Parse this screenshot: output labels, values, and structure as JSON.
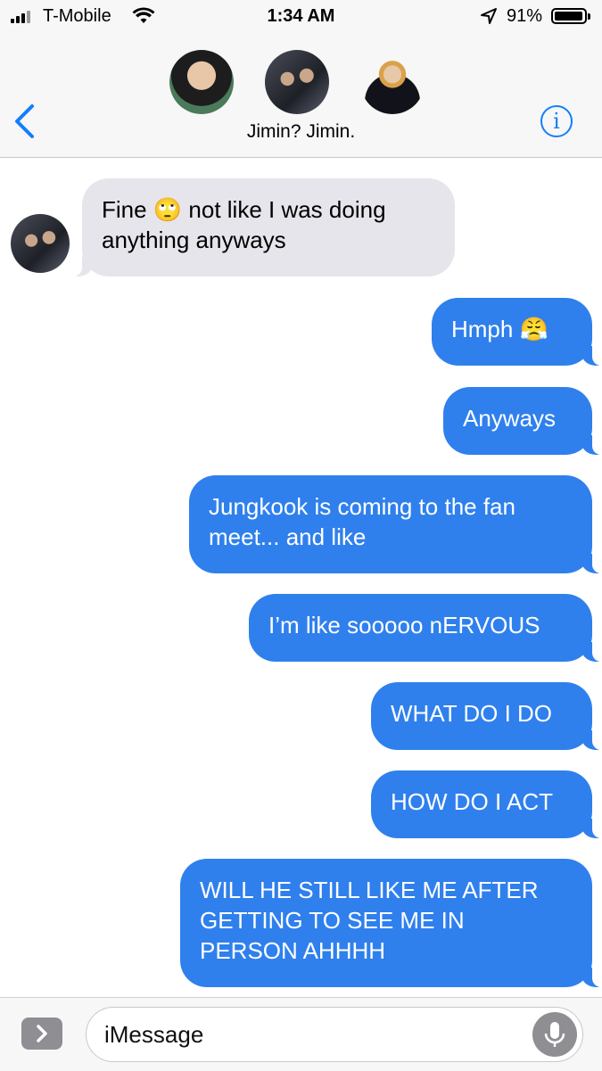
{
  "status_bar": {
    "carrier": "T-Mobile",
    "time": "1:34 AM",
    "battery_percent": "91%",
    "battery_level": 0.91
  },
  "header": {
    "group_name": "Jimin? Jimin.",
    "back_icon": "chevron-left-icon",
    "info_icon": "info-icon",
    "info_label": "i",
    "accent_color": "#147efb"
  },
  "messages": [
    {
      "direction": "incoming",
      "text": "Fine 🙄 not like I was doing\nanything anyways"
    },
    {
      "direction": "outgoing",
      "text": "Hmph 😤"
    },
    {
      "direction": "outgoing",
      "text": "Anyways"
    },
    {
      "direction": "outgoing",
      "text": "Jungkook is coming to the fan\nmeet... and like"
    },
    {
      "direction": "outgoing",
      "text": "I’m like sooooo nERVOUS"
    },
    {
      "direction": "outgoing",
      "text": "WHAT DO I DO"
    },
    {
      "direction": "outgoing",
      "text": "HOW DO I ACT"
    },
    {
      "direction": "outgoing",
      "text": "WILL HE STILL LIKE ME AFTER\nGETTING TO SEE ME IN\nPERSON AHHHH"
    }
  ],
  "composer": {
    "placeholder": "iMessage",
    "apps_icon": "chevron-right-icon",
    "mic_icon": "microphone-icon"
  },
  "colors": {
    "outgoing_bubble": "#2f80ed",
    "incoming_bubble": "#e6e5eb"
  }
}
